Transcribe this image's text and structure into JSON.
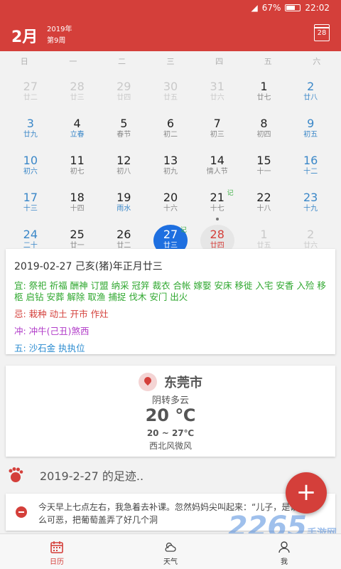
{
  "status": {
    "battery": "67%",
    "battery_level": 0.67,
    "time": "22:02"
  },
  "header": {
    "month": "2月",
    "year": "2019年",
    "week": "第9周",
    "today_day": "28"
  },
  "weekdays": [
    "日",
    "一",
    "二",
    "三",
    "四",
    "五",
    "六"
  ],
  "calendar": {
    "rows": [
      [
        {
          "d": "27",
          "l": "廿二",
          "s": "dim"
        },
        {
          "d": "28",
          "l": "廿三",
          "s": "dim"
        },
        {
          "d": "29",
          "l": "廿四",
          "s": "dim"
        },
        {
          "d": "30",
          "l": "廿五",
          "s": "dim"
        },
        {
          "d": "31",
          "l": "廿六",
          "s": "dim"
        },
        {
          "d": "1",
          "l": "廿七",
          "s": ""
        },
        {
          "d": "2",
          "l": "廿八",
          "s": "weekend"
        }
      ],
      [
        {
          "d": "3",
          "l": "廿九",
          "s": "weekend"
        },
        {
          "d": "4",
          "l": "立春",
          "s": "term"
        },
        {
          "d": "5",
          "l": "春节",
          "s": ""
        },
        {
          "d": "6",
          "l": "初二",
          "s": ""
        },
        {
          "d": "7",
          "l": "初三",
          "s": ""
        },
        {
          "d": "8",
          "l": "初四",
          "s": ""
        },
        {
          "d": "9",
          "l": "初五",
          "s": "weekend"
        }
      ],
      [
        {
          "d": "10",
          "l": "初六",
          "s": "weekend"
        },
        {
          "d": "11",
          "l": "初七",
          "s": ""
        },
        {
          "d": "12",
          "l": "初八",
          "s": ""
        },
        {
          "d": "13",
          "l": "初九",
          "s": ""
        },
        {
          "d": "14",
          "l": "情人节",
          "s": ""
        },
        {
          "d": "15",
          "l": "十一",
          "s": ""
        },
        {
          "d": "16",
          "l": "十二",
          "s": "weekend"
        }
      ],
      [
        {
          "d": "17",
          "l": "十三",
          "s": "weekend"
        },
        {
          "d": "18",
          "l": "十四",
          "s": ""
        },
        {
          "d": "19",
          "l": "雨水",
          "s": "term"
        },
        {
          "d": "20",
          "l": "十六",
          "s": ""
        },
        {
          "d": "21",
          "l": "十七",
          "s": "",
          "note": "记",
          "dot": true
        },
        {
          "d": "22",
          "l": "十八",
          "s": ""
        },
        {
          "d": "23",
          "l": "十九",
          "s": "weekend"
        }
      ],
      [
        {
          "d": "24",
          "l": "二十",
          "s": "weekend"
        },
        {
          "d": "25",
          "l": "廿一",
          "s": ""
        },
        {
          "d": "26",
          "l": "廿二",
          "s": ""
        },
        {
          "d": "27",
          "l": "廿三",
          "s": "selected",
          "note": "记",
          "dot": true
        },
        {
          "d": "28",
          "l": "廿四",
          "s": "today"
        },
        {
          "d": "1",
          "l": "廿五",
          "s": "dim"
        },
        {
          "d": "2",
          "l": "廿六",
          "s": "dim"
        }
      ]
    ]
  },
  "almanac": {
    "date_line": "2019-02-27   己亥(猪)年正月廿三",
    "yi": "宜: 祭祀 祈福 酬神 订盟 纳采 冠笄 裁衣 合帐 嫁娶 安床 移徙 入宅 安香 入殓 移柩 启钻 安葬 解除 取渔 捕捉 伐木 安门 出火",
    "ji": "忌: 栽种 动土 开市 作灶",
    "chong": "冲: 冲牛(己丑)煞西",
    "wu": "五: 沙石金 执执位"
  },
  "weather": {
    "city": "东莞市",
    "condition": "阴转多云",
    "temp": "20 ℃",
    "range": "20 ~ 27℃",
    "wind": "西北风微风"
  },
  "footprint": {
    "text": "2019-2-27 的足迹.."
  },
  "diary": {
    "text": "今天早上七点左右，我急着去补课。忽然妈妈尖叫起来：“儿子，是谁这么可恶，把葡萄盖弄了好几个洞"
  },
  "fab": {
    "label": "+"
  },
  "tabs": [
    {
      "label": "日历"
    },
    {
      "label": "天气"
    },
    {
      "label": "我"
    }
  ],
  "watermark": {
    "big": "2265",
    "small": "手游网"
  },
  "colors": {
    "brand": "#d43f3a",
    "selected": "#1e6fe0",
    "yi": "#2ea72e",
    "ji": "#d43f3a",
    "chong": "#b03ac8",
    "wu": "#2a8bd0"
  }
}
